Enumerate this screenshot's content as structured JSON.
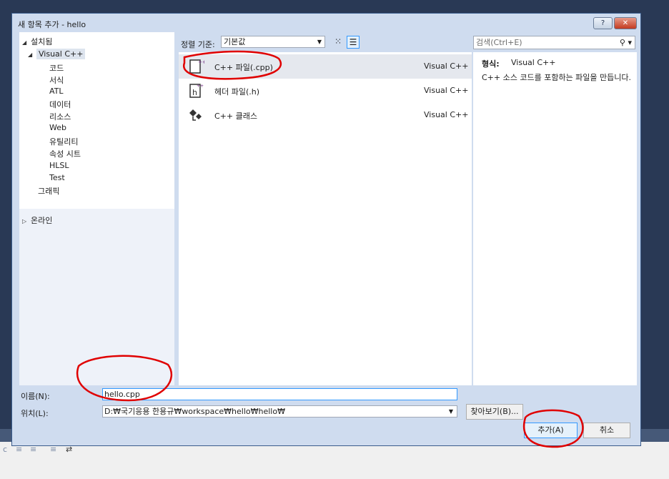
{
  "dialog": {
    "title": "새 항목 추가 - hello",
    "help_btn": "?",
    "close_btn": "✕"
  },
  "tree": {
    "installed": "설치됨",
    "visual_cpp": "Visual C++",
    "children": [
      "코드",
      "서식",
      "ATL",
      "데이터",
      "리소스",
      "Web",
      "유틸리티",
      "속성 시트",
      "HLSL",
      "Test"
    ],
    "graphics": "그래픽",
    "online": "온라인"
  },
  "toolbar": {
    "sort_label": "정렬 기준:",
    "sort_value": "기본값",
    "search_placeholder": "검색(Ctrl+E)"
  },
  "templates": [
    {
      "icon": "cpp-file-icon",
      "name": "C++ 파일(.cpp)",
      "lang": "Visual C++",
      "selected": true
    },
    {
      "icon": "header-file-icon",
      "name": "헤더 파일(.h)",
      "lang": "Visual C++",
      "selected": false
    },
    {
      "icon": "cpp-class-icon",
      "name": "C++ 클래스",
      "lang": "Visual C++",
      "selected": false
    }
  ],
  "info": {
    "type_label": "형식:",
    "type_value": "Visual C++",
    "description": "C++ 소스 코드를 포함하는 파일을 만듭니다."
  },
  "form": {
    "name_label": "이름(N):",
    "name_value": "hello.cpp",
    "location_label": "위치(L):",
    "location_value": "D:₩국기응용 한용규₩workspace₩hello₩hello₩",
    "browse_label": "찾아보기(B)...",
    "add_label": "추가(A)",
    "cancel_label": "취소"
  },
  "colors": {
    "annotation": "#e00000",
    "selection": "#e5e8ee",
    "accent": "#3399ff"
  }
}
